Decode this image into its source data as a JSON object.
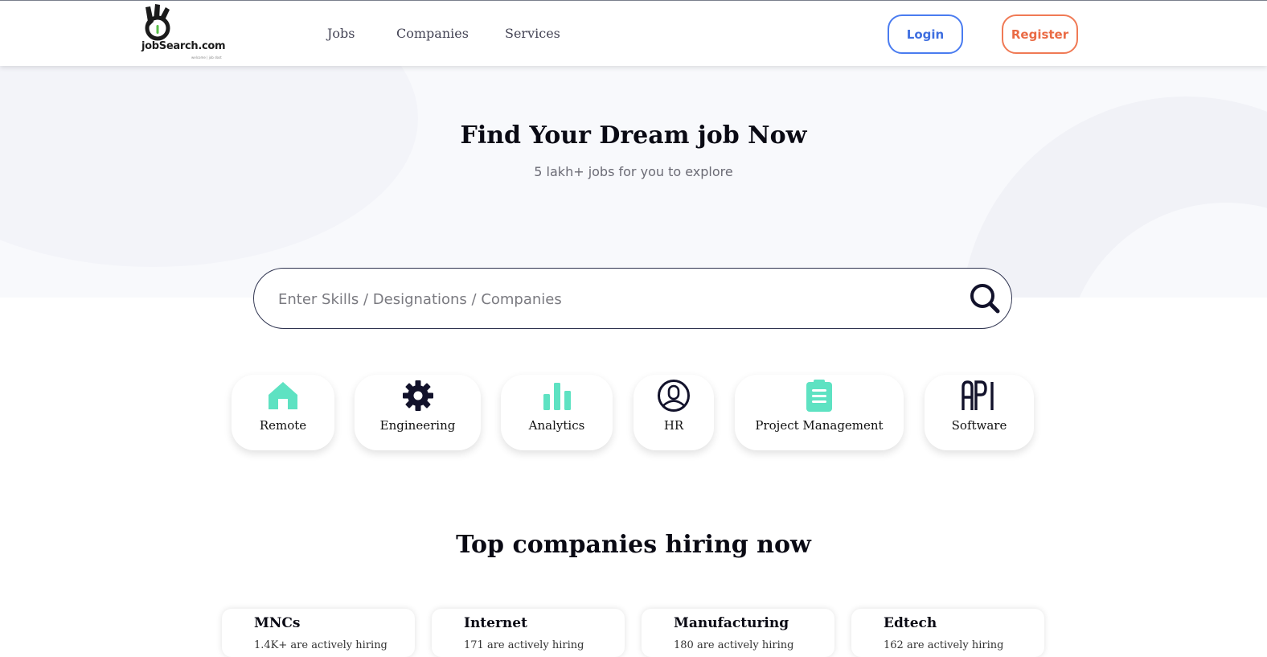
{
  "header": {
    "logo_text": "jobSearch.com",
    "logo_tagline": "welcome | job dost",
    "nav": [
      "Jobs",
      "Companies",
      "Services"
    ],
    "login_label": "Login",
    "register_label": "Register",
    "colors": {
      "login": "#3f6fe0",
      "register": "#ea6b45"
    }
  },
  "hero": {
    "title": "Find Your Dream job Now",
    "subtitle": "5 lakh+ jobs for you to explore"
  },
  "search": {
    "placeholder": "Enter Skills / Designations / Companies",
    "value": "",
    "icon": "search-icon"
  },
  "categories": [
    {
      "label": "Remote",
      "icon": "home-icon",
      "color": "#5ee2c2"
    },
    {
      "label": "Engineering",
      "icon": "gear-icon",
      "color": "#12122b"
    },
    {
      "label": "Analytics",
      "icon": "bar-chart-icon",
      "color": "#5ee2c2"
    },
    {
      "label": "HR",
      "icon": "user-circle-icon",
      "color": "#12122b"
    },
    {
      "label": "Project Management",
      "icon": "clipboard-icon",
      "color": "#5ee2c2"
    },
    {
      "label": "Software",
      "icon": "api-icon",
      "color": "#12122b"
    }
  ],
  "companies_section": {
    "title": "Top companies hiring now",
    "cards": [
      {
        "name": "MNCs",
        "sub": "1.4K+ are actively hiring"
      },
      {
        "name": "Internet",
        "sub": "171 are actively hiring"
      },
      {
        "name": "Manufacturing",
        "sub": "180 are actively hiring"
      },
      {
        "name": "Edtech",
        "sub": "162 are actively hiring"
      }
    ]
  }
}
